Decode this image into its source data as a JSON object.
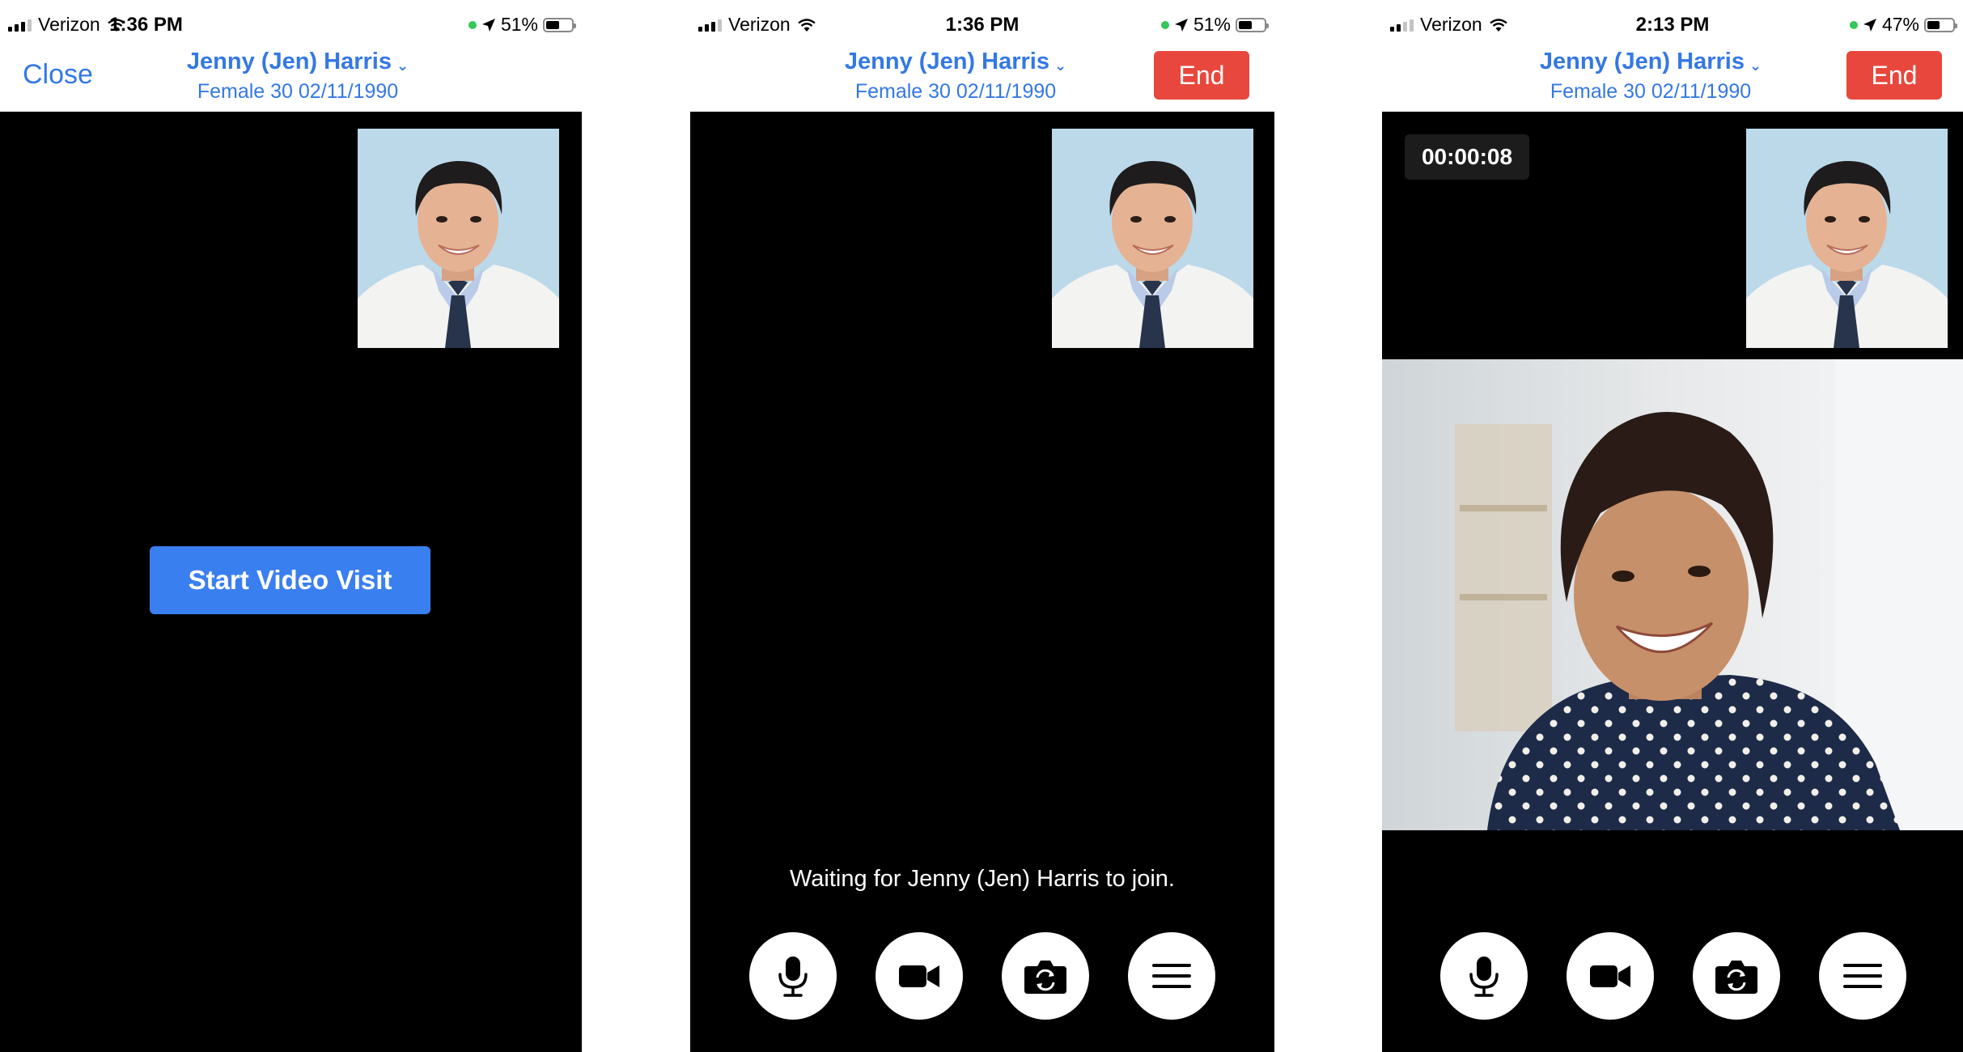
{
  "screens": [
    {
      "status": {
        "carrier": "Verizon",
        "time": "1:36 PM",
        "battery": "51%",
        "battery_level": 0.51
      },
      "header": {
        "close_label": "Close",
        "patient_name": "Jenny (Jen) Harris",
        "patient_details": "Female 30 02/11/1990"
      },
      "start_button_label": "Start Video Visit"
    },
    {
      "status": {
        "carrier": "Verizon",
        "time": "1:36 PM",
        "battery": "51%",
        "battery_level": 0.51
      },
      "header": {
        "end_label": "End",
        "patient_name": "Jenny (Jen) Harris",
        "patient_details": "Female 30 02/11/1990"
      },
      "waiting_text": "Waiting for Jenny (Jen) Harris to join.",
      "controls": [
        "microphone-icon",
        "video-camera-icon",
        "switch-camera-icon",
        "menu-icon"
      ]
    },
    {
      "status": {
        "carrier": "Verizon",
        "time": "2:13 PM",
        "battery": "47%",
        "battery_level": 0.47
      },
      "header": {
        "end_label": "End",
        "patient_name": "Jenny (Jen) Harris",
        "patient_details": "Female 30 02/11/1990"
      },
      "call_timer": "00:00:08",
      "controls": [
        "microphone-icon",
        "video-camera-icon",
        "switch-camera-icon",
        "menu-icon"
      ]
    }
  ],
  "colors": {
    "accent_blue": "#3478e4",
    "start_button": "#3a7ff0",
    "end_button": "#e8473d",
    "video_background": "#000000",
    "location_dot": "#34c759"
  }
}
